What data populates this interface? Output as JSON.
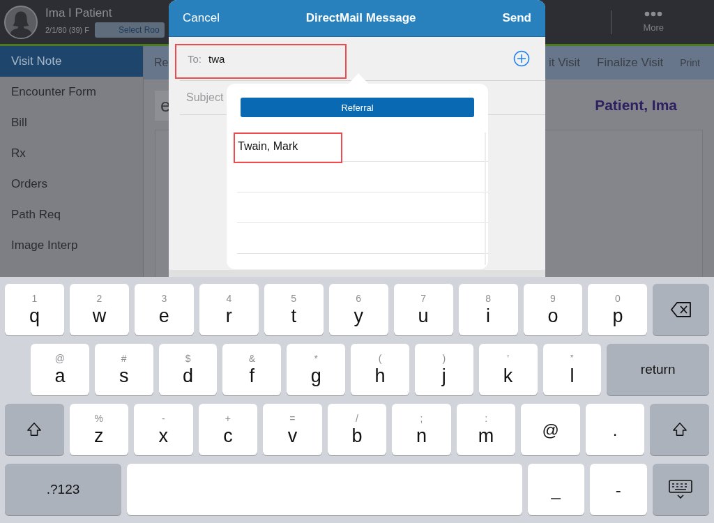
{
  "patient": {
    "name": "Ima I Patient",
    "dob": "2/1/80 (39) F",
    "room_button": "Select Roo"
  },
  "top_bar": {
    "more": "More"
  },
  "sidebar": {
    "items": [
      {
        "label": "Visit Note",
        "selected": true
      },
      {
        "label": "Encounter Form",
        "selected": false
      },
      {
        "label": "Bill",
        "selected": false
      },
      {
        "label": "Rx",
        "selected": false
      },
      {
        "label": "Orders",
        "selected": false
      },
      {
        "label": "Path Req",
        "selected": false
      },
      {
        "label": "Image Interp",
        "selected": false
      }
    ]
  },
  "toolbar": {
    "left": "Re",
    "right": [
      "it Visit",
      "Finalize Visit",
      "Print"
    ]
  },
  "content": {
    "fragment": "e",
    "patient_name": "Patient, Ima"
  },
  "modal": {
    "cancel": "Cancel",
    "title": "DirectMail Message",
    "send": "Send",
    "to_label": "To:",
    "to_value": "twa",
    "subject_placeholder": "Subject"
  },
  "popover": {
    "tab": "Referral",
    "results": [
      "Twain, Mark"
    ]
  },
  "keyboard": {
    "rows": [
      {
        "keys": [
          {
            "kind": "char",
            "label": "q",
            "hint": "1"
          },
          {
            "kind": "char",
            "label": "w",
            "hint": "2"
          },
          {
            "kind": "char",
            "label": "e",
            "hint": "3"
          },
          {
            "kind": "char",
            "label": "r",
            "hint": "4"
          },
          {
            "kind": "char",
            "label": "t",
            "hint": "5"
          },
          {
            "kind": "char",
            "label": "y",
            "hint": "6"
          },
          {
            "kind": "char",
            "label": "u",
            "hint": "7"
          },
          {
            "kind": "char",
            "label": "i",
            "hint": "8"
          },
          {
            "kind": "char",
            "label": "o",
            "hint": "9"
          },
          {
            "kind": "char",
            "label": "p",
            "hint": "0"
          },
          {
            "kind": "backspace"
          }
        ]
      },
      {
        "keys": [
          {
            "kind": "char",
            "label": "a",
            "hint": "@"
          },
          {
            "kind": "char",
            "label": "s",
            "hint": "#"
          },
          {
            "kind": "char",
            "label": "d",
            "hint": "$"
          },
          {
            "kind": "char",
            "label": "f",
            "hint": "&"
          },
          {
            "kind": "char",
            "label": "g",
            "hint": "*"
          },
          {
            "kind": "char",
            "label": "h",
            "hint": "("
          },
          {
            "kind": "char",
            "label": "j",
            "hint": ")"
          },
          {
            "kind": "char",
            "label": "k",
            "hint": "’"
          },
          {
            "kind": "char",
            "label": "l",
            "hint": "”"
          },
          {
            "kind": "return",
            "label": "return"
          }
        ]
      },
      {
        "keys": [
          {
            "kind": "shift"
          },
          {
            "kind": "char",
            "label": "z",
            "hint": "%"
          },
          {
            "kind": "char",
            "label": "x",
            "hint": "-"
          },
          {
            "kind": "char",
            "label": "c",
            "hint": "+"
          },
          {
            "kind": "char",
            "label": "v",
            "hint": "="
          },
          {
            "kind": "char",
            "label": "b",
            "hint": "/"
          },
          {
            "kind": "char",
            "label": "n",
            "hint": ";"
          },
          {
            "kind": "char",
            "label": "m",
            "hint": ":"
          },
          {
            "kind": "char",
            "label": "@"
          },
          {
            "kind": "char",
            "label": "."
          },
          {
            "kind": "shift"
          }
        ]
      },
      {
        "keys": [
          {
            "kind": "mode",
            "label": ".?123"
          },
          {
            "kind": "space"
          },
          {
            "kind": "char",
            "label": "_"
          },
          {
            "kind": "char",
            "label": "-"
          },
          {
            "kind": "dismiss"
          }
        ]
      }
    ]
  }
}
